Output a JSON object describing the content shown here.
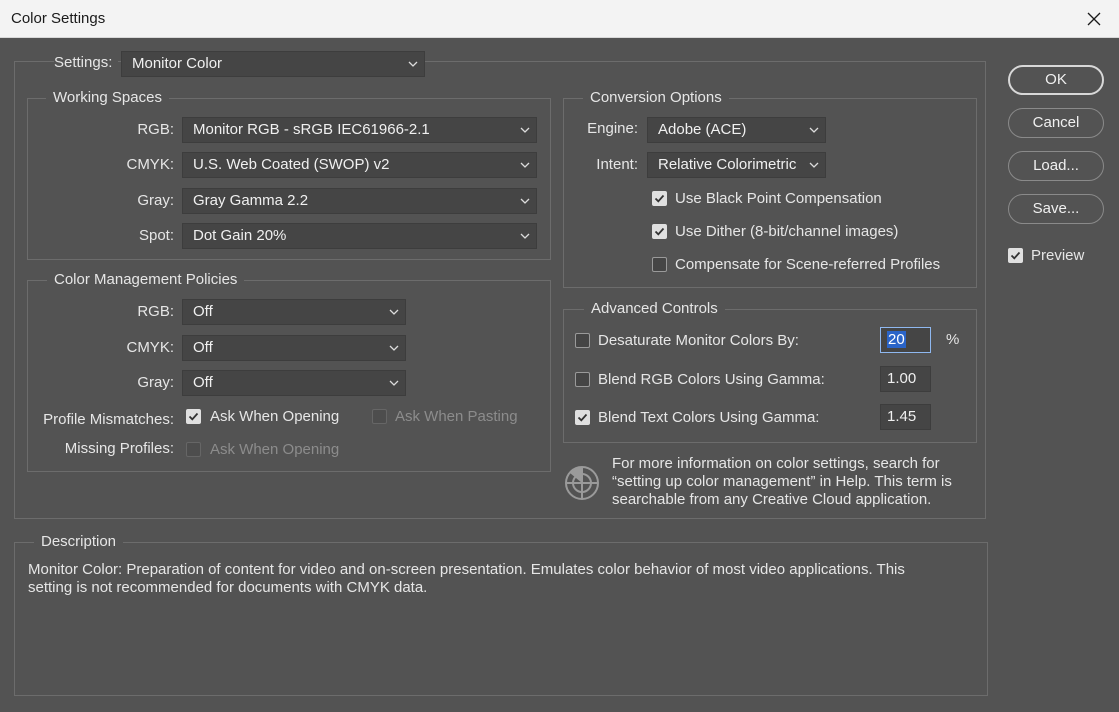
{
  "window": {
    "title": "Color Settings"
  },
  "settings": {
    "label": "Settings:",
    "value": "Monitor Color"
  },
  "working_spaces": {
    "legend": "Working Spaces",
    "rgb": {
      "label": "RGB:",
      "value": "Monitor RGB - sRGB IEC61966-2.1"
    },
    "cmyk": {
      "label": "CMYK:",
      "value": "U.S. Web Coated (SWOP) v2"
    },
    "gray": {
      "label": "Gray:",
      "value": "Gray Gamma 2.2"
    },
    "spot": {
      "label": "Spot:",
      "value": "Dot Gain 20%"
    }
  },
  "policies": {
    "legend": "Color Management Policies",
    "rgb": {
      "label": "RGB:",
      "value": "Off"
    },
    "cmyk": {
      "label": "CMYK:",
      "value": "Off"
    },
    "gray": {
      "label": "Gray:",
      "value": "Off"
    },
    "profile_mismatches": {
      "label": "Profile Mismatches:",
      "ask_opening": {
        "label": "Ask When Opening",
        "checked": true
      },
      "ask_pasting": {
        "label": "Ask When Pasting",
        "checked": false
      }
    },
    "missing_profiles": {
      "label": "Missing Profiles:",
      "ask_opening": {
        "label": "Ask When Opening",
        "checked": false
      }
    }
  },
  "conversion": {
    "legend": "Conversion Options",
    "engine": {
      "label": "Engine:",
      "value": "Adobe (ACE)"
    },
    "intent": {
      "label": "Intent:",
      "value": "Relative Colorimetric"
    },
    "black_point": {
      "label": "Use Black Point Compensation",
      "checked": true
    },
    "dither": {
      "label": "Use Dither (8-bit/channel images)",
      "checked": true
    },
    "scene_referred": {
      "label": "Compensate for Scene-referred Profiles",
      "checked": false
    }
  },
  "advanced": {
    "legend": "Advanced Controls",
    "desaturate": {
      "label": "Desaturate Monitor Colors By:",
      "value": "20",
      "unit": "%",
      "checked": false
    },
    "blend_rgb": {
      "label": "Blend RGB Colors Using Gamma:",
      "value": "1.00",
      "checked": false
    },
    "blend_text": {
      "label": "Blend Text Colors Using Gamma:",
      "value": "1.45",
      "checked": true
    }
  },
  "info": {
    "line1": "For more information on color settings, search for",
    "line2": "“setting up color management” in Help. This term is",
    "line3": "searchable from any Creative Cloud application."
  },
  "description": {
    "legend": "Description",
    "line1": "Monitor Color:  Preparation of content for video and on-screen presentation. Emulates color behavior of most video applications. This",
    "line2": "setting is not recommended for documents with CMYK data."
  },
  "buttons": {
    "ok": "OK",
    "cancel": "Cancel",
    "load": "Load...",
    "save": "Save..."
  },
  "preview": {
    "label": "Preview",
    "checked": true
  },
  "icons": {
    "close": "close-icon",
    "chevron": "chevron-down-icon",
    "check": "check-icon",
    "info": "color-wheel-icon"
  }
}
